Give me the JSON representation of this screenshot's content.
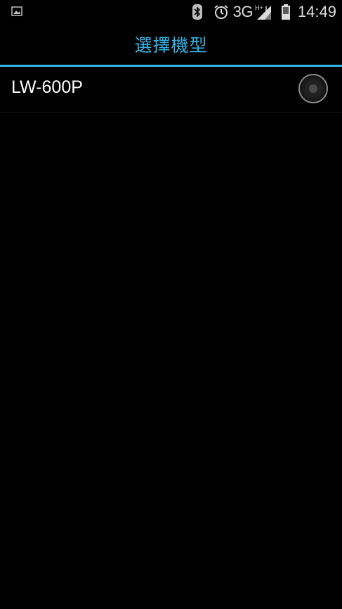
{
  "status_bar": {
    "left_icons": [
      "image-notification-icon"
    ],
    "right_icons": [
      "bluetooth-icon",
      "alarm-icon",
      "signal-icon",
      "battery-icon"
    ],
    "network_type": "3G",
    "time": "14:49"
  },
  "header": {
    "title": "選擇機型"
  },
  "list": {
    "items": [
      {
        "label": "LW-600P",
        "selected": false
      }
    ]
  },
  "colors": {
    "accent": "#33b5e5",
    "background": "#000000",
    "text": "#ffffff"
  }
}
